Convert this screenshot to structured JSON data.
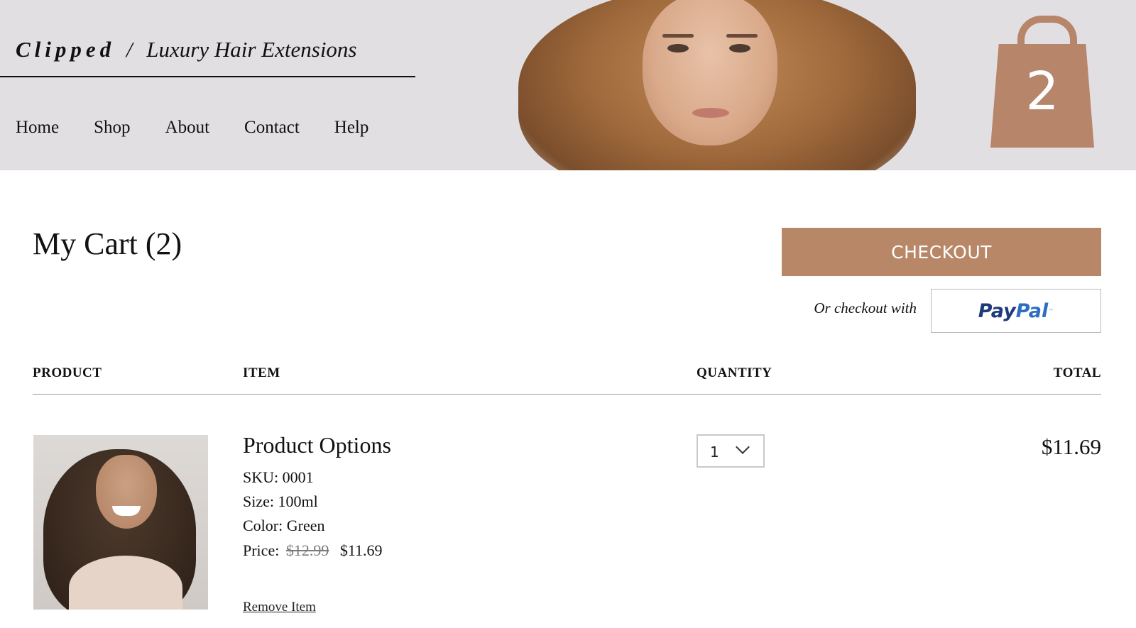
{
  "header": {
    "brand_name": "Clipped",
    "brand_separator": "/",
    "brand_tagline": "Luxury Hair Extensions",
    "nav": [
      "Home",
      "Shop",
      "About",
      "Contact",
      "Help"
    ],
    "cart_count": "2"
  },
  "cart": {
    "title": "My Cart (2)",
    "checkout_label": "CHECKOUT",
    "alt_checkout_label": "Or checkout with",
    "paypal_pay": "Pay",
    "paypal_pal": "Pal",
    "paypal_tm": "™",
    "columns": {
      "product": "PRODUCT",
      "item": "ITEM",
      "quantity": "QUANTITY",
      "total": "TOTAL"
    },
    "items": [
      {
        "name": "Product Options",
        "sku": "SKU: 0001",
        "size": "Size: 100ml",
        "color": "Color: Green",
        "price_label": "Price:",
        "original_price": "$12.99",
        "sale_price": "$11.69",
        "quantity": "1",
        "total": "$11.69",
        "remove_label": "Remove Item"
      }
    ]
  },
  "colors": {
    "accent": "#b88767",
    "header_bg": "#e2dfe3",
    "paypal_dark": "#1f3a7a",
    "paypal_light": "#2e6dc1"
  },
  "icons": [
    "shopping-bag-icon",
    "chevron-down-icon"
  ]
}
